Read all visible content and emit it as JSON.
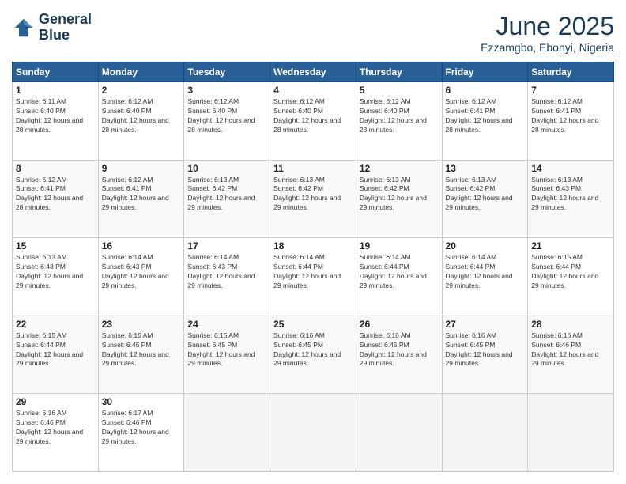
{
  "header": {
    "logo_line1": "General",
    "logo_line2": "Blue",
    "month": "June 2025",
    "location": "Ezzamgbo, Ebonyi, Nigeria"
  },
  "weekdays": [
    "Sunday",
    "Monday",
    "Tuesday",
    "Wednesday",
    "Thursday",
    "Friday",
    "Saturday"
  ],
  "weeks": [
    [
      {
        "day": 1,
        "sunrise": "6:11 AM",
        "sunset": "6:40 PM",
        "daylight": "12 hours and 28 minutes."
      },
      {
        "day": 2,
        "sunrise": "6:12 AM",
        "sunset": "6:40 PM",
        "daylight": "12 hours and 28 minutes."
      },
      {
        "day": 3,
        "sunrise": "6:12 AM",
        "sunset": "6:40 PM",
        "daylight": "12 hours and 28 minutes."
      },
      {
        "day": 4,
        "sunrise": "6:12 AM",
        "sunset": "6:40 PM",
        "daylight": "12 hours and 28 minutes."
      },
      {
        "day": 5,
        "sunrise": "6:12 AM",
        "sunset": "6:40 PM",
        "daylight": "12 hours and 28 minutes."
      },
      {
        "day": 6,
        "sunrise": "6:12 AM",
        "sunset": "6:41 PM",
        "daylight": "12 hours and 28 minutes."
      },
      {
        "day": 7,
        "sunrise": "6:12 AM",
        "sunset": "6:41 PM",
        "daylight": "12 hours and 28 minutes."
      }
    ],
    [
      {
        "day": 8,
        "sunrise": "6:12 AM",
        "sunset": "6:41 PM",
        "daylight": "12 hours and 28 minutes."
      },
      {
        "day": 9,
        "sunrise": "6:12 AM",
        "sunset": "6:41 PM",
        "daylight": "12 hours and 29 minutes."
      },
      {
        "day": 10,
        "sunrise": "6:13 AM",
        "sunset": "6:42 PM",
        "daylight": "12 hours and 29 minutes."
      },
      {
        "day": 11,
        "sunrise": "6:13 AM",
        "sunset": "6:42 PM",
        "daylight": "12 hours and 29 minutes."
      },
      {
        "day": 12,
        "sunrise": "6:13 AM",
        "sunset": "6:42 PM",
        "daylight": "12 hours and 29 minutes."
      },
      {
        "day": 13,
        "sunrise": "6:13 AM",
        "sunset": "6:42 PM",
        "daylight": "12 hours and 29 minutes."
      },
      {
        "day": 14,
        "sunrise": "6:13 AM",
        "sunset": "6:43 PM",
        "daylight": "12 hours and 29 minutes."
      }
    ],
    [
      {
        "day": 15,
        "sunrise": "6:13 AM",
        "sunset": "6:43 PM",
        "daylight": "12 hours and 29 minutes."
      },
      {
        "day": 16,
        "sunrise": "6:14 AM",
        "sunset": "6:43 PM",
        "daylight": "12 hours and 29 minutes."
      },
      {
        "day": 17,
        "sunrise": "6:14 AM",
        "sunset": "6:43 PM",
        "daylight": "12 hours and 29 minutes."
      },
      {
        "day": 18,
        "sunrise": "6:14 AM",
        "sunset": "6:44 PM",
        "daylight": "12 hours and 29 minutes."
      },
      {
        "day": 19,
        "sunrise": "6:14 AM",
        "sunset": "6:44 PM",
        "daylight": "12 hours and 29 minutes."
      },
      {
        "day": 20,
        "sunrise": "6:14 AM",
        "sunset": "6:44 PM",
        "daylight": "12 hours and 29 minutes."
      },
      {
        "day": 21,
        "sunrise": "6:15 AM",
        "sunset": "6:44 PM",
        "daylight": "12 hours and 29 minutes."
      }
    ],
    [
      {
        "day": 22,
        "sunrise": "6:15 AM",
        "sunset": "6:44 PM",
        "daylight": "12 hours and 29 minutes."
      },
      {
        "day": 23,
        "sunrise": "6:15 AM",
        "sunset": "6:45 PM",
        "daylight": "12 hours and 29 minutes."
      },
      {
        "day": 24,
        "sunrise": "6:15 AM",
        "sunset": "6:45 PM",
        "daylight": "12 hours and 29 minutes."
      },
      {
        "day": 25,
        "sunrise": "6:16 AM",
        "sunset": "6:45 PM",
        "daylight": "12 hours and 29 minutes."
      },
      {
        "day": 26,
        "sunrise": "6:16 AM",
        "sunset": "6:45 PM",
        "daylight": "12 hours and 29 minutes."
      },
      {
        "day": 27,
        "sunrise": "6:16 AM",
        "sunset": "6:45 PM",
        "daylight": "12 hours and 29 minutes."
      },
      {
        "day": 28,
        "sunrise": "6:16 AM",
        "sunset": "6:46 PM",
        "daylight": "12 hours and 29 minutes."
      }
    ],
    [
      {
        "day": 29,
        "sunrise": "6:16 AM",
        "sunset": "6:46 PM",
        "daylight": "12 hours and 29 minutes."
      },
      {
        "day": 30,
        "sunrise": "6:17 AM",
        "sunset": "6:46 PM",
        "daylight": "12 hours and 29 minutes."
      },
      null,
      null,
      null,
      null,
      null
    ]
  ]
}
